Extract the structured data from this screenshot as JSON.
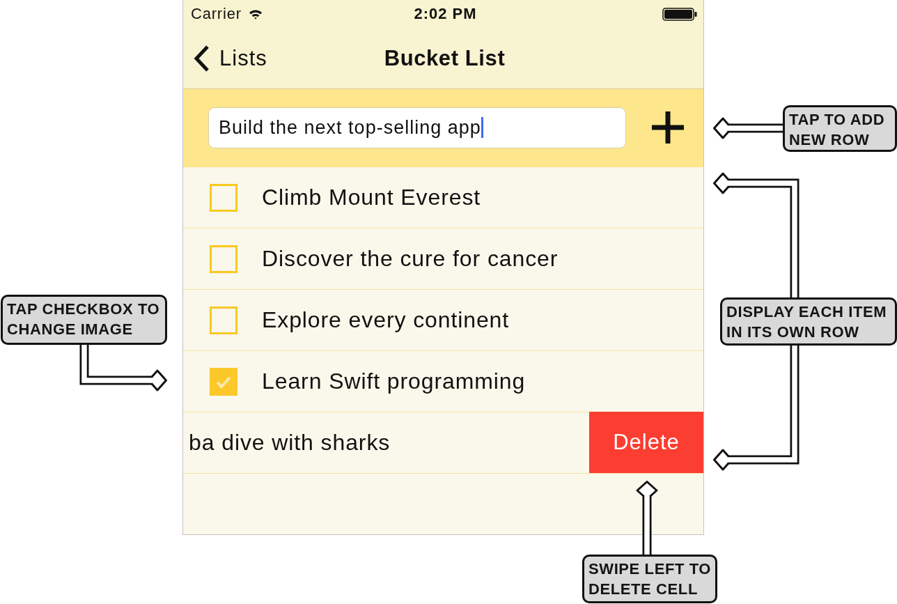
{
  "status_bar": {
    "carrier": "Carrier",
    "time": "2:02 PM"
  },
  "nav_bar": {
    "back_label": "Lists",
    "title": "Bucket List"
  },
  "add_row": {
    "value": "Build the next top-selling app"
  },
  "items": [
    {
      "kind": "checkbox",
      "text": "Climb Mount Everest",
      "checked": false
    },
    {
      "kind": "checkbox",
      "text": "Discover the cure for cancer",
      "checked": false
    },
    {
      "kind": "checkbox",
      "text": "Explore every continent",
      "checked": false
    },
    {
      "kind": "checkbox",
      "text": "Learn Swift programming",
      "checked": true
    },
    {
      "kind": "swiped",
      "text": "ba dive with sharks",
      "action": "Delete"
    }
  ],
  "callouts": [
    {
      "kind": "add",
      "lines": [
        "TAP TO ADD",
        "NEW ROW"
      ]
    },
    {
      "kind": "checkbox",
      "lines": [
        "TAP CHECKBOX TO",
        "CHANGE IMAGE"
      ]
    },
    {
      "kind": "rows",
      "lines": [
        "DISPLAY EACH ITEM",
        "IN ITS OWN ROW"
      ]
    },
    {
      "kind": "delete",
      "lines": [
        "SWIPE LEFT TO",
        "DELETE CELL"
      ]
    }
  ]
}
